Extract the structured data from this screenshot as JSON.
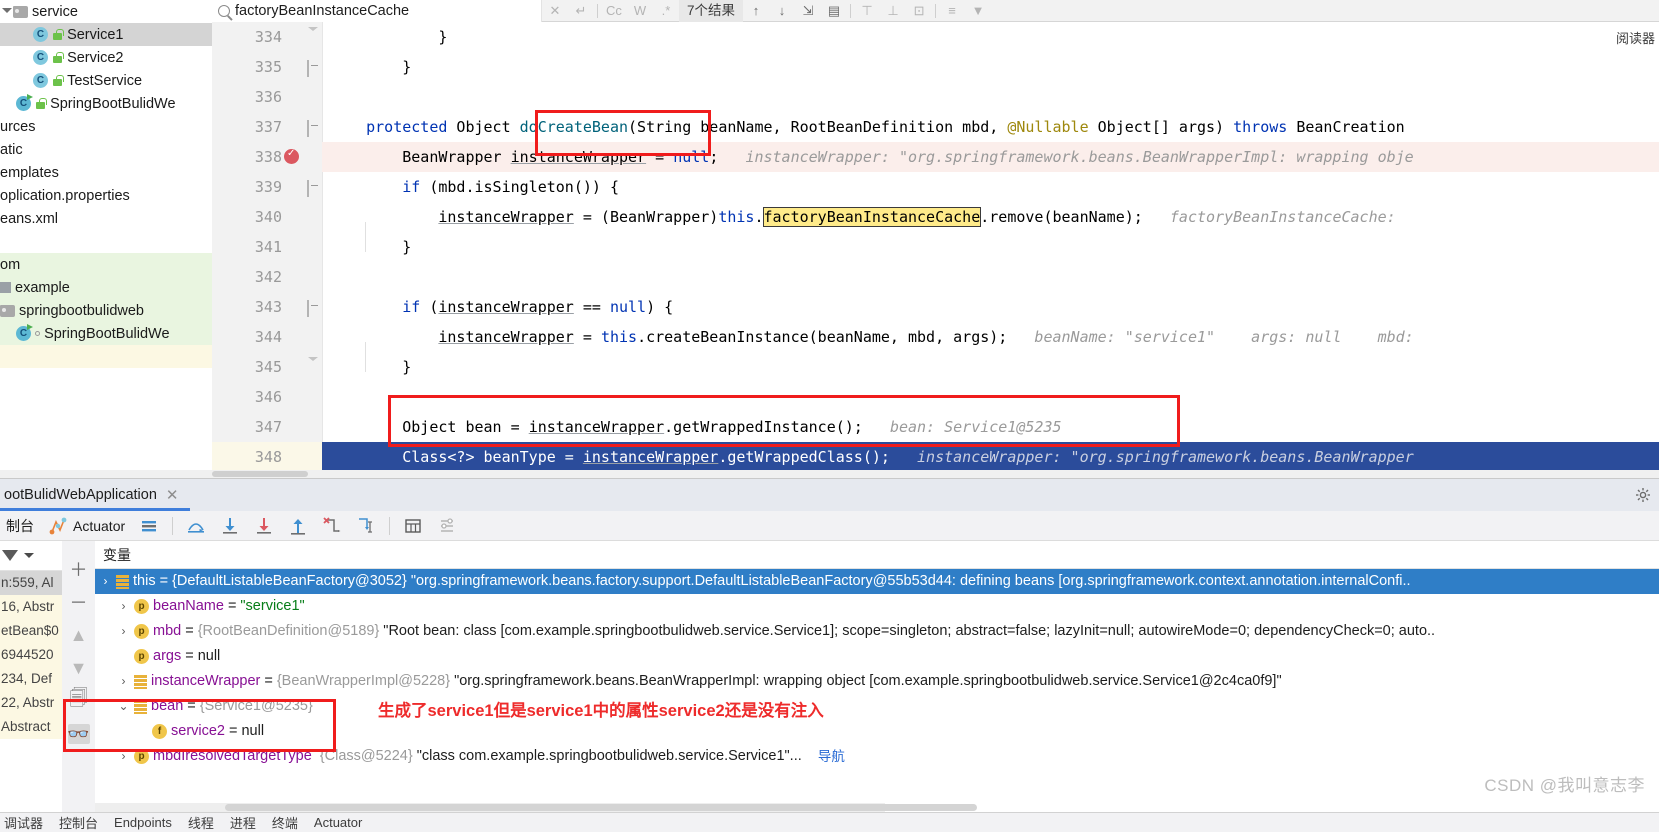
{
  "project_tree": {
    "rows": [
      {
        "indent": 1,
        "icons": [
          "chevron-down",
          "folder"
        ],
        "label": "service",
        "state": "normal"
      },
      {
        "indent": 3,
        "icons": [
          "class",
          "lock"
        ],
        "label": "Service1",
        "state": "selected"
      },
      {
        "indent": 3,
        "icons": [
          "class",
          "lock"
        ],
        "label": "Service2",
        "state": "normal"
      },
      {
        "indent": 3,
        "icons": [
          "class",
          "lock"
        ],
        "label": "TestService",
        "state": "normal"
      },
      {
        "indent": 2,
        "icons": [
          "class-run",
          "lock"
        ],
        "label": "SpringBootBulidWe",
        "state": "normal"
      },
      {
        "indent": 0,
        "icons": [],
        "label": "urces",
        "state": "normal"
      },
      {
        "indent": 0,
        "icons": [],
        "label": "atic",
        "state": "normal"
      },
      {
        "indent": 0,
        "icons": [],
        "label": "emplates",
        "state": "normal"
      },
      {
        "indent": 0,
        "icons": [],
        "label": "oplication.properties",
        "state": "normal"
      },
      {
        "indent": 0,
        "icons": [],
        "label": "eans.xml",
        "state": "normal"
      },
      {
        "indent": 0,
        "icons": [],
        "label": "",
        "state": "normal"
      },
      {
        "indent": 0,
        "icons": [],
        "label": "om",
        "state": "green"
      },
      {
        "indent": 0,
        "icons": [
          "square"
        ],
        "label": "example",
        "state": "green"
      },
      {
        "indent": 1,
        "icons": [
          "folder"
        ],
        "label": "springbootbulidweb",
        "state": "green"
      },
      {
        "indent": 2,
        "icons": [
          "class-run",
          "dot"
        ],
        "label": "SpringBootBulidWe",
        "state": "green"
      },
      {
        "indent": 0,
        "icons": [],
        "label": "",
        "state": "yellow"
      }
    ]
  },
  "search": {
    "query": "factoryBeanInstanceCache",
    "result_count": "7个结果",
    "buttons": [
      "close-icon",
      "enter-icon",
      "match-case-icon",
      "words-icon",
      "regex-icon",
      "prev-icon",
      "next-icon",
      "select-all-icon",
      "open-in-new-icon",
      "filter-top-icon",
      "filter-bottom-icon",
      "filter-new-icon",
      "filter-list-icon",
      "filter-icon"
    ],
    "button_labels": {
      "match_case": "Cc",
      "words": "W",
      "regex": ".*"
    },
    "reader_mode": "阅读器"
  },
  "editor": {
    "lines": [
      {
        "num": "334",
        "fold": "tail",
        "bp": false,
        "hl": "none",
        "tokens": [
          {
            "t": "            }",
            "c": "plain"
          }
        ]
      },
      {
        "num": "335",
        "fold": "sq",
        "bp": false,
        "hl": "none",
        "tokens": [
          {
            "t": "        }",
            "c": "plain"
          }
        ]
      },
      {
        "num": "336",
        "fold": "none",
        "bp": false,
        "hl": "none",
        "tokens": [
          {
            "t": "",
            "c": "plain"
          }
        ]
      },
      {
        "num": "337",
        "fold": "sq",
        "bp": false,
        "hl": "none",
        "tokens": [
          {
            "t": "    ",
            "c": "plain"
          },
          {
            "t": "protected",
            "c": "k"
          },
          {
            "t": " Object ",
            "c": "plain"
          },
          {
            "t": "doCreateBean",
            "c": "m"
          },
          {
            "t": "(String beanName, RootBeanDefinition mbd, ",
            "c": "plain"
          },
          {
            "t": "@Nullable",
            "c": "an"
          },
          {
            "t": " Object[] args) ",
            "c": "plain"
          },
          {
            "t": "throws",
            "c": "k"
          },
          {
            "t": " BeanCreation",
            "c": "plain"
          }
        ]
      },
      {
        "num": "338",
        "fold": "none",
        "bp": true,
        "hl": "pink",
        "tokens": [
          {
            "t": "        BeanWrapper ",
            "c": "plain"
          },
          {
            "t": "instanceWrapper",
            "c": "u"
          },
          {
            "t": " = ",
            "c": "plain"
          },
          {
            "t": "null",
            "c": "k"
          },
          {
            "t": ";   ",
            "c": "plain"
          },
          {
            "t": "instanceWrapper: \"org.springframework.beans.BeanWrapperImpl: wrapping obje",
            "c": "hint"
          }
        ]
      },
      {
        "num": "339",
        "fold": "sq",
        "bp": false,
        "hl": "none",
        "tokens": [
          {
            "t": "        ",
            "c": "plain"
          },
          {
            "t": "if",
            "c": "k"
          },
          {
            "t": " (mbd.isSingleton()) {",
            "c": "plain"
          }
        ]
      },
      {
        "num": "340",
        "fold": "none",
        "bp": false,
        "hl": "none",
        "tokens": [
          {
            "t": "            ",
            "c": "plain"
          },
          {
            "t": "instanceWrapper",
            "c": "u"
          },
          {
            "t": " = (BeanWrapper)",
            "c": "plain"
          },
          {
            "t": "this",
            "c": "k"
          },
          {
            "t": ".",
            "c": "plain"
          },
          {
            "t": "factoryBeanInstanceCache",
            "c": "mark"
          },
          {
            "t": ".remove(beanName);   ",
            "c": "plain"
          },
          {
            "t": "factoryBeanInstanceCache:",
            "c": "hint"
          }
        ]
      },
      {
        "num": "341",
        "fold": "none",
        "bp": false,
        "hl": "none",
        "tokens": [
          {
            "t": "        }",
            "c": "plain"
          }
        ]
      },
      {
        "num": "342",
        "fold": "none",
        "bp": false,
        "hl": "none",
        "tokens": [
          {
            "t": "",
            "c": "plain"
          }
        ]
      },
      {
        "num": "343",
        "fold": "sq",
        "bp": false,
        "hl": "none",
        "tokens": [
          {
            "t": "        ",
            "c": "plain"
          },
          {
            "t": "if",
            "c": "k"
          },
          {
            "t": " (",
            "c": "plain"
          },
          {
            "t": "instanceWrapper",
            "c": "u"
          },
          {
            "t": " == ",
            "c": "plain"
          },
          {
            "t": "null",
            "c": "k"
          },
          {
            "t": ") {",
            "c": "plain"
          }
        ]
      },
      {
        "num": "344",
        "fold": "none",
        "bp": false,
        "hl": "none",
        "tokens": [
          {
            "t": "            ",
            "c": "plain"
          },
          {
            "t": "instanceWrapper",
            "c": "u"
          },
          {
            "t": " = ",
            "c": "plain"
          },
          {
            "t": "this",
            "c": "k"
          },
          {
            "t": ".createBeanInstance(beanName, mbd, args);   ",
            "c": "plain"
          },
          {
            "t": "beanName: \"service1\"    args: null    mbd:",
            "c": "hint"
          }
        ]
      },
      {
        "num": "345",
        "fold": "tail",
        "bp": false,
        "hl": "none",
        "tokens": [
          {
            "t": "        }",
            "c": "plain"
          }
        ]
      },
      {
        "num": "346",
        "fold": "none",
        "bp": false,
        "hl": "none",
        "tokens": [
          {
            "t": "",
            "c": "plain"
          }
        ]
      },
      {
        "num": "347",
        "fold": "none",
        "bp": false,
        "hl": "none",
        "tokens": [
          {
            "t": "        Object bean = ",
            "c": "plain"
          },
          {
            "t": "instanceWrapper",
            "c": "u"
          },
          {
            "t": ".getWrappedInstance();   ",
            "c": "plain"
          },
          {
            "t": "bean: Service1@5235",
            "c": "hint"
          }
        ]
      },
      {
        "num": "348",
        "fold": "none",
        "bp": false,
        "hl": "blue",
        "tokens": [
          {
            "t": "        Class<?> beanType = ",
            "c": "wh"
          },
          {
            "t": "instanceWrapper",
            "c": "wh-u"
          },
          {
            "t": ".getWrappedClass();   ",
            "c": "wh"
          },
          {
            "t": "instanceWrapper: \"org.springframework.beans.BeanWrapper",
            "c": "hint-w"
          }
        ]
      }
    ]
  },
  "debug": {
    "tab_title": "ootBulidWebApplication",
    "toolbar": {
      "console_label": "制台",
      "actuator_label": "Actuator",
      "icons": [
        "layout-icon",
        "step-over-icon",
        "step-into-icon",
        "force-step-into-icon",
        "step-out-icon",
        "drop-frame-icon",
        "run-to-cursor-icon",
        "evaluate-icon",
        "settings-list-icon"
      ]
    },
    "vars_header": "变量",
    "variables": [
      {
        "arrow": "›",
        "icon": "obj",
        "name": "this",
        "eq": " = ",
        "ref": "{DefaultListableBeanFactory@3052}",
        "value": " \"org.springframework.beans.factory.support.DefaultListableBeanFactory@55b53d44: defining beans [org.springframework.context.annotation.internalConfi..",
        "selected": true,
        "indent": 0
      },
      {
        "arrow": "›",
        "icon": "p",
        "name": "beanName",
        "eq": " = ",
        "ref": "",
        "value": "\"service1\"",
        "value_kind": "string",
        "selected": false,
        "indent": 1
      },
      {
        "arrow": "›",
        "icon": "p",
        "name": "mbd",
        "eq": " = ",
        "ref": "{RootBeanDefinition@5189}",
        "value": " \"Root bean: class [com.example.springbootbulidweb.service.Service1]; scope=singleton; abstract=false; lazyInit=null; autowireMode=0; dependencyCheck=0; auto..",
        "selected": false,
        "indent": 1
      },
      {
        "arrow": "",
        "icon": "p",
        "name": "args",
        "eq": " = ",
        "ref": "",
        "value": "null",
        "selected": false,
        "indent": 1
      },
      {
        "arrow": "›",
        "icon": "obj",
        "name": "instanceWrapper",
        "eq": " = ",
        "ref": "{BeanWrapperImpl@5228}",
        "value": " \"org.springframework.beans.BeanWrapperImpl: wrapping object [com.example.springbootbulidweb.service.Service1@2c4ca0f9]\"",
        "selected": false,
        "indent": 1
      },
      {
        "arrow": "⌄",
        "icon": "obj",
        "name": "bean",
        "eq": " = ",
        "ref": "{Service1@5235}",
        "value": "",
        "selected": false,
        "indent": 1
      },
      {
        "arrow": "",
        "icon": "f",
        "name": "service2",
        "eq": " = ",
        "ref": "",
        "value": "null",
        "selected": false,
        "indent": 2
      },
      {
        "arrow": "›",
        "icon": "p",
        "name": "mbdIresolvedTargetType",
        "eq": "",
        "ref": "{Class@5224}",
        "value": " \"class com.example.springbootbulidweb.service.Service1\"...",
        "selected": false,
        "indent": 1,
        "nav_label": "导航"
      }
    ],
    "frames": [
      {
        "label": "n:559, Al",
        "state": "selected"
      },
      {
        "label": "16, Abstr",
        "state": "yellow"
      },
      {
        "label": "etBean$0",
        "state": "yellow"
      },
      {
        "label": "6944520",
        "state": "yellow"
      },
      {
        "label": "234, Def",
        "state": "yellow"
      },
      {
        "label": "22, Abstr",
        "state": "yellow"
      },
      {
        "label": "Abstract",
        "state": "yellow"
      }
    ],
    "frame_tools": [
      "add-icon",
      "remove-icon",
      "up-icon",
      "down-icon",
      "copy-icon",
      "watches-icon"
    ]
  },
  "annotation": {
    "chinese_note": "生成了service1但是service1中的属性service2还是没有注入",
    "red_box_color": "#f01c1c"
  },
  "watermark": "CSDN @我叫意志李",
  "statusbar": {
    "items": [
      "调试器",
      "控制台",
      "Endpoints",
      "线程",
      "进程",
      "终端",
      "Actuator"
    ]
  }
}
